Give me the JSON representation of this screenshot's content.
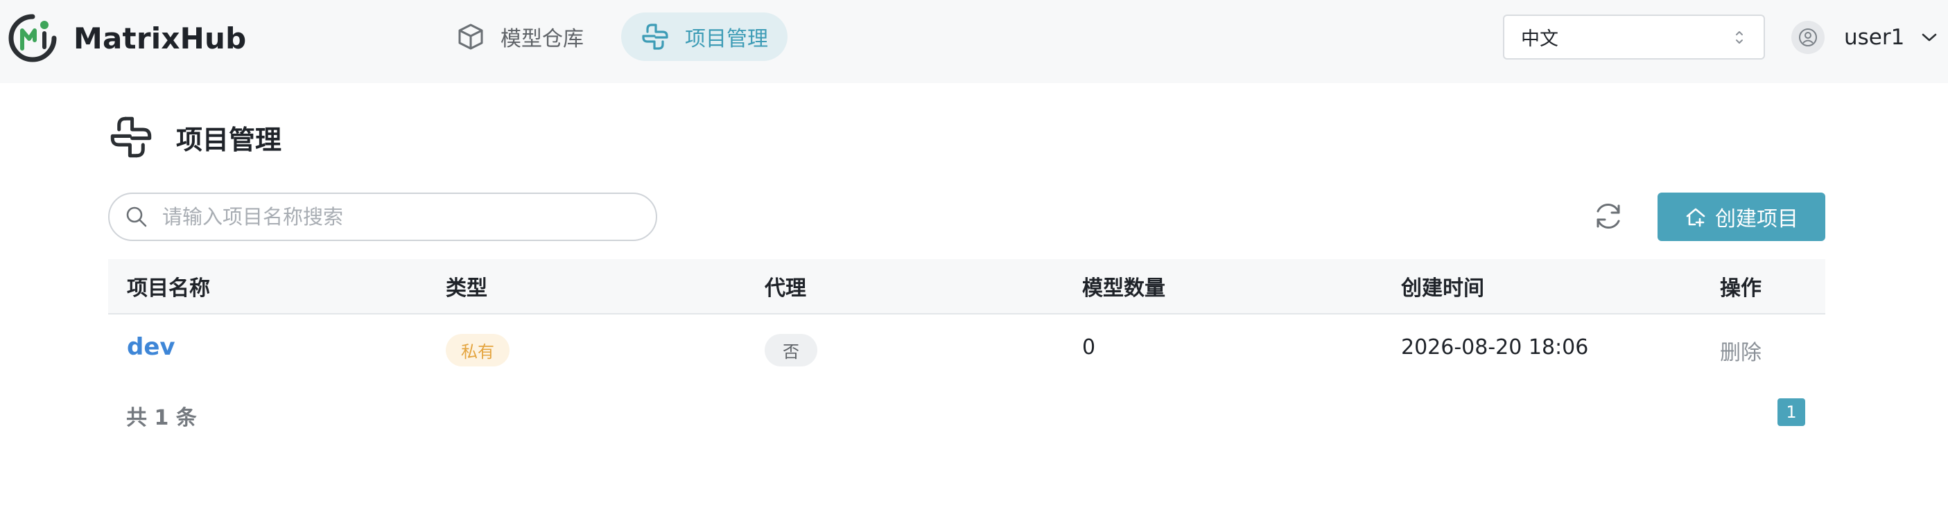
{
  "app": {
    "name": "MatrixHub",
    "brand_color": "#3ea55a"
  },
  "nav": {
    "items": [
      {
        "label": "模型仓库",
        "icon": "cube-icon",
        "active": false
      },
      {
        "label": "项目管理",
        "icon": "project-icon",
        "active": true
      }
    ]
  },
  "header": {
    "language": {
      "selected": "中文"
    },
    "user": {
      "name": "user1",
      "icon": "user-circle-icon"
    }
  },
  "page": {
    "title": "项目管理",
    "title_icon": "project-icon"
  },
  "toolbar": {
    "search_placeholder": "请输入项目名称搜索",
    "search_value": "",
    "refresh_icon": "refresh-icon",
    "create_label": "创建项目",
    "create_icon": "home-plus-icon",
    "accent_color": "#4aa3bb"
  },
  "table": {
    "columns": [
      "项目名称",
      "类型",
      "代理",
      "模型数量",
      "创建时间",
      "操作"
    ],
    "rows": [
      {
        "name": "dev",
        "type": "私有",
        "proxy": "否",
        "model_count": "0",
        "created": "2026-08-20 18:06",
        "action": "删除"
      }
    ]
  },
  "pagination": {
    "total_text": "共 1 条",
    "current_page": "1"
  }
}
